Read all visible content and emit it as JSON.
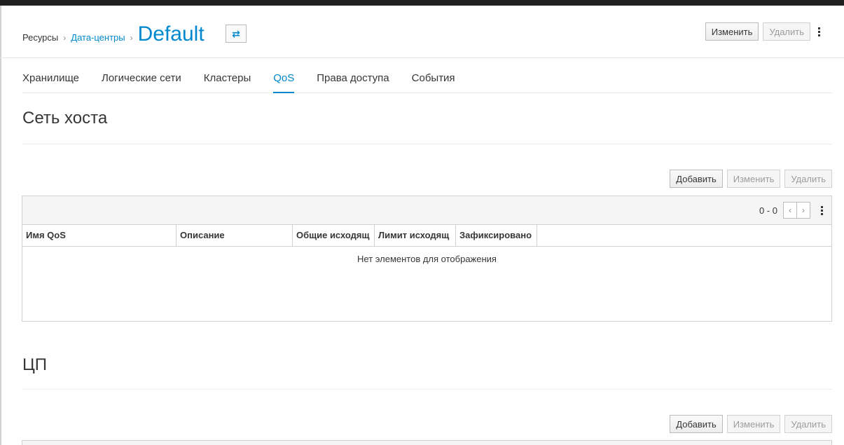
{
  "breadcrumb": {
    "root": "Ресурсы",
    "separator": "›",
    "parent": "Дата-центры",
    "title": "Default"
  },
  "header_actions": {
    "switch_icon": "⇄",
    "edit": "Изменить",
    "delete": "Удалить"
  },
  "tabs": [
    {
      "label": "Хранилище"
    },
    {
      "label": "Логические сети"
    },
    {
      "label": "Кластеры"
    },
    {
      "label": "QoS"
    },
    {
      "label": "Права доступа"
    },
    {
      "label": "События"
    }
  ],
  "active_tab": "QoS",
  "sections": {
    "host_network": {
      "title": "Сеть хоста",
      "toolbar": {
        "add": "Добавить",
        "edit": "Изменить",
        "delete": "Удалить"
      },
      "pager": {
        "range": "0 - 0",
        "prev": "‹",
        "next": "›"
      },
      "columns": [
        "Имя QoS",
        "Описание",
        "Общие исходящ",
        "Лимит исходящ",
        "Зафиксировано"
      ],
      "empty_message": "Нет элементов для отображения"
    },
    "cpu": {
      "title": "ЦП",
      "toolbar": {
        "add": "Добавить",
        "edit": "Изменить",
        "delete": "Удалить"
      }
    }
  },
  "colors": {
    "accent": "#0088ce",
    "text": "#363636",
    "border": "#d1d1d1"
  }
}
